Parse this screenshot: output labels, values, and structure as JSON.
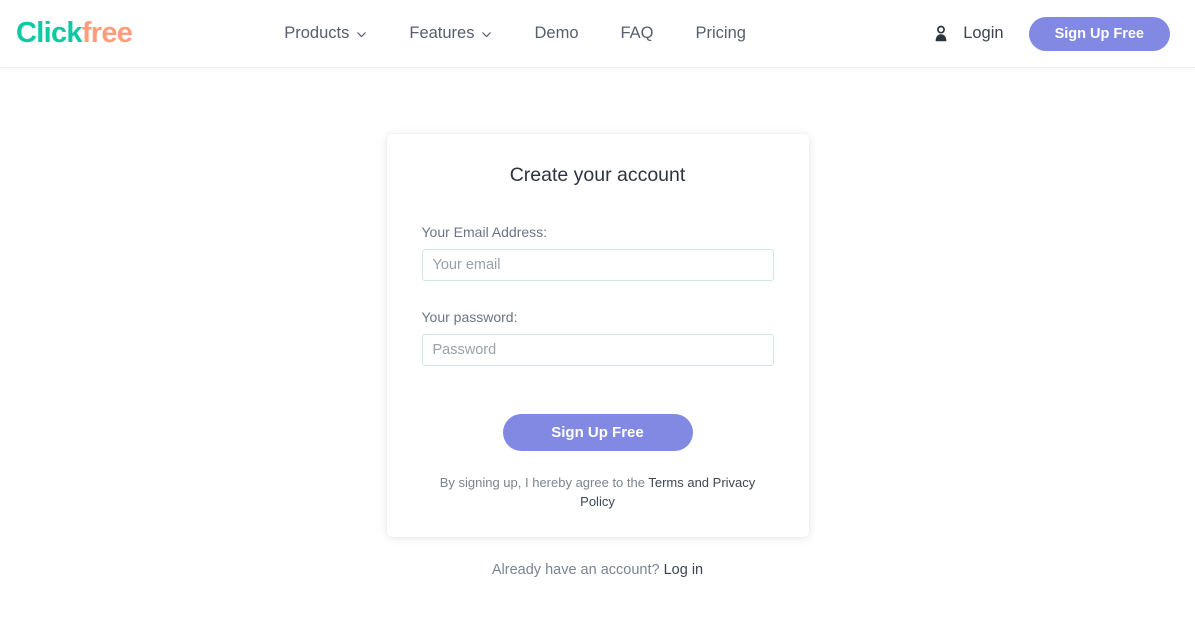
{
  "brand": {
    "name_part1": "Click",
    "name_part2": "free",
    "color_primary": "#0ec9a3",
    "color_secondary": "#ff9e7a",
    "accent_purple": "#8189e3",
    "input_border": "#cfe9dd"
  },
  "header": {
    "nav": [
      {
        "label": "Products",
        "has_chevron": true,
        "icon": "chevron-down-icon"
      },
      {
        "label": "Features",
        "has_chevron": true,
        "icon": "chevron-down-icon"
      },
      {
        "label": "Demo",
        "has_chevron": false,
        "icon": ""
      },
      {
        "label": "FAQ",
        "has_chevron": false,
        "icon": ""
      },
      {
        "label": "Pricing",
        "has_chevron": false,
        "icon": ""
      }
    ],
    "user_icon": "user-icon",
    "login_label": "Login",
    "signup_label": "Sign Up Free"
  },
  "card": {
    "title": "Create your account",
    "fields": [
      {
        "label": "Your Email Address:",
        "placeholder": "Your email",
        "value": "",
        "type": "email"
      },
      {
        "label": "Your password:",
        "placeholder": "Password",
        "value": "",
        "type": "password"
      }
    ],
    "submit_label": "Sign Up Free",
    "terms_prefix": "By signing up, I hereby agree to the ",
    "terms_link": "Terms and Privacy Policy"
  },
  "footer": {
    "already_text": "Already have an account? ",
    "login_link": "Log in"
  }
}
